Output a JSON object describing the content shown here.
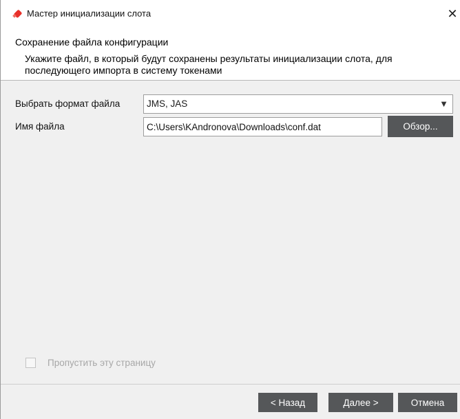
{
  "window": {
    "title": "Мастер инициализации слота",
    "app_icon": "usb-token-icon",
    "close_symbol": "✕"
  },
  "header": {
    "title": "Сохранение файла конфигурации",
    "description": "Укажите файл, в который будут сохранены результаты инициализации слота, для последующего импорта в систему токенами"
  },
  "form": {
    "format_label": "Выбрать формат файла",
    "format_value": "JMS, JAS",
    "format_arrow": "▼",
    "filename_label": "Имя файла",
    "filename_value": "C:\\Users\\KAndronova\\Downloads\\conf.dat",
    "browse_label": "Обзор..."
  },
  "skip": {
    "label": "Пропустить эту страницу",
    "checked": false
  },
  "footer": {
    "back_label": "< Назад",
    "next_label": "Далее >",
    "cancel_label": "Отмена"
  },
  "colors": {
    "button_bg": "#555759",
    "icon_red": "#e8302a"
  }
}
